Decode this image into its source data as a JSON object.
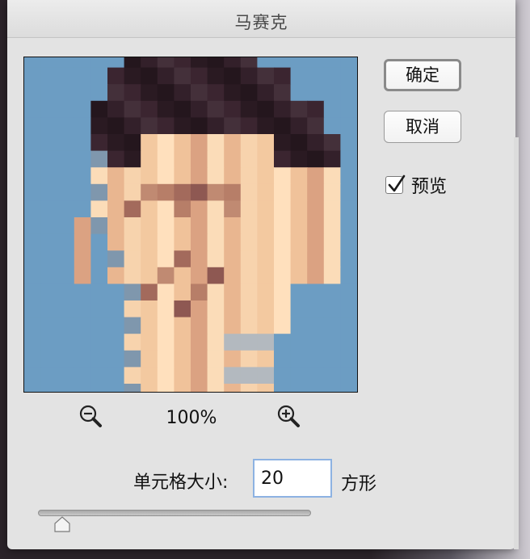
{
  "window": {
    "title": "马赛克"
  },
  "buttons": {
    "ok_label": "确定",
    "cancel_label": "取消"
  },
  "preview_checkbox": {
    "label": "预览",
    "checked": true
  },
  "zoom": {
    "level": "100%",
    "zoom_out_icon": "zoom-out-magnifier-icon",
    "zoom_in_icon": "zoom-in-magnifier-icon"
  },
  "cell_size": {
    "label": "单元格大小:",
    "value": "20",
    "unit": "方形"
  },
  "slider": {
    "value_fraction": 0.08
  },
  "colors": {
    "dialog_bg": "#e3e3e3",
    "preview_bg": "#6c9dc3",
    "input_focus_border": "#8db2e2"
  }
}
